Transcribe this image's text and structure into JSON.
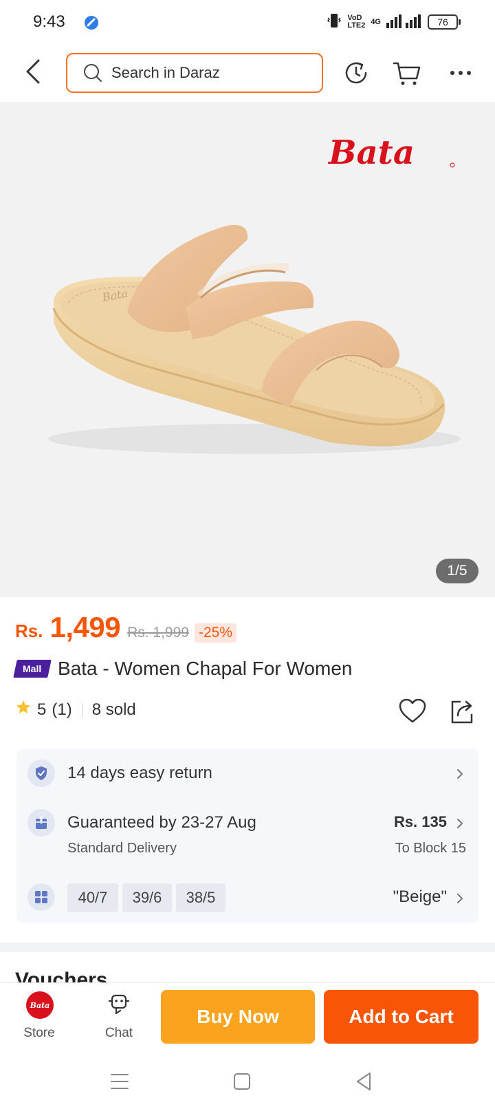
{
  "status_bar": {
    "time": "9:43",
    "network_label": "VoD LTE2",
    "signal_label": "4G",
    "battery": "76"
  },
  "header": {
    "search_placeholder": "Search in Daraz",
    "icons": [
      "back-icon",
      "search-icon",
      "history-icon",
      "cart-icon",
      "more-icon"
    ]
  },
  "gallery": {
    "counter": "1/5",
    "brand_logo": "Bata"
  },
  "price": {
    "currency": "Rs.",
    "current": "1,499",
    "original": "Rs. 1,999",
    "discount": "-25%"
  },
  "product": {
    "mall_badge": "Mall",
    "title": "Bata - Women Chapal For Women",
    "rating": "5",
    "rating_count": "(1)",
    "sold": "8 sold"
  },
  "info": {
    "return_text": "14 days easy return",
    "delivery_text": "Guaranteed by 23-27 Aug",
    "delivery_type": "Standard Delivery",
    "delivery_price": "Rs. 135",
    "delivery_location": "To Block 15",
    "sizes": [
      "40/7",
      "39/6",
      "38/5"
    ],
    "color": "\"Beige\""
  },
  "vouchers": {
    "title": "Vouchers"
  },
  "action_bar": {
    "store_label": "Store",
    "store_logo": "Bata",
    "chat_label": "Chat",
    "buy_now": "Buy Now",
    "add_to_cart": "Add to Cart"
  },
  "colors": {
    "accent": "#f85606",
    "buy_now": "#fba31f",
    "mall": "#4b1f9e",
    "bata_red": "#d9111d"
  }
}
